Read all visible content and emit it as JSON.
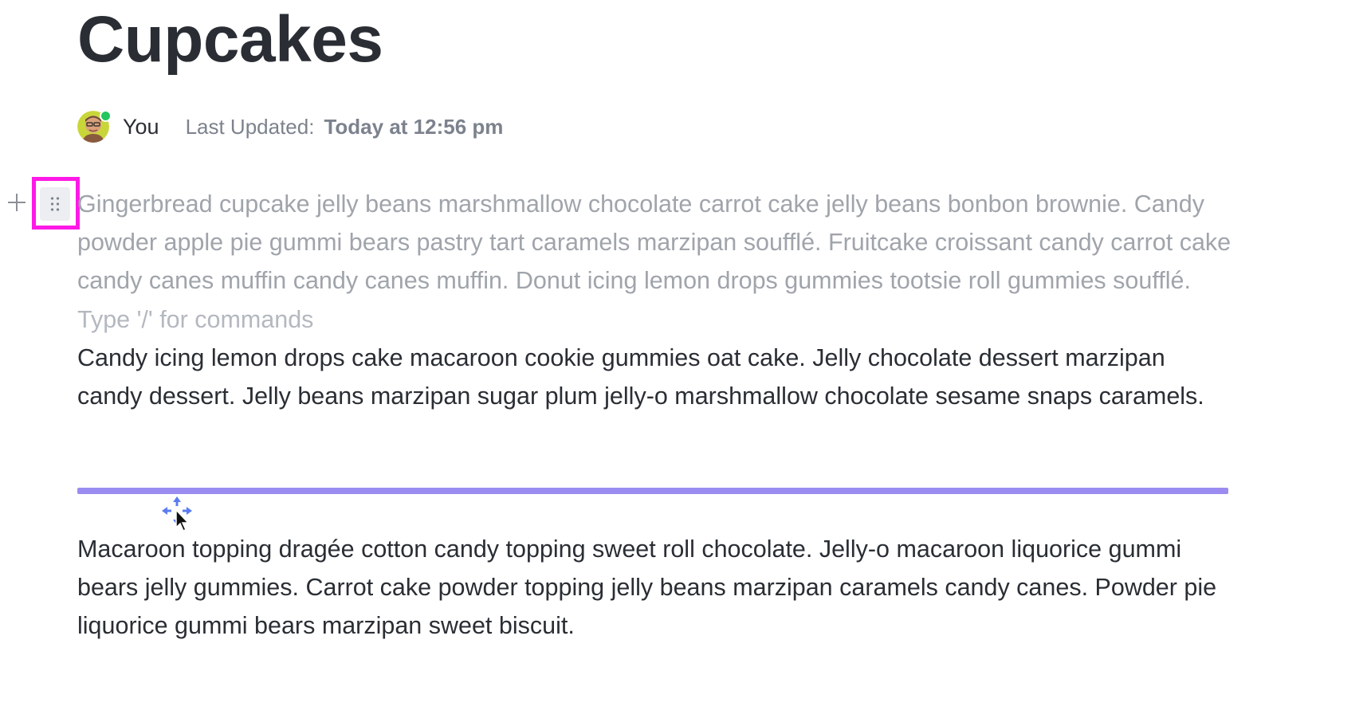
{
  "document": {
    "title": "Cupcakes"
  },
  "meta": {
    "author": "You",
    "updated_label": "Last Updated:",
    "updated_value": "Today at 12:56 pm",
    "presence_color": "#22c55e"
  },
  "block_controls": {
    "add_icon": "plus-icon",
    "drag_icon": "drag-handle-icon",
    "highlight_color": "#ff19e6"
  },
  "blocks": {
    "dragging_paragraph": "Gingerbread cupcake jelly beans marshmallow chocolate carrot cake jelly beans bonbon brownie. Candy powder apple pie gummi bears pastry tart caramels marzipan soufflé. Fruitcake croissant candy carrot cake candy canes muffin candy canes muffin. Donut icing lemon drops gummies tootsie roll gummies soufflé.",
    "empty_placeholder": "Type '/' for commands",
    "paragraph_2": "Candy icing lemon drops cake macaroon cookie gummies oat cake. Jelly chocolate dessert marzipan candy dessert. Jelly beans marzipan sugar plum jelly-o marshmallow chocolate sesame snaps caramels.",
    "paragraph_3": "Macaroon topping dragée cotton candy topping sweet roll chocolate. Jelly-o macaroon liquorice gummi bears jelly gummies. Carrot cake powder topping jelly beans marzipan caramels candy canes. Powder pie liquorice gummi bears marzipan sweet biscuit."
  },
  "drop_indicator": {
    "color": "#9b8cf0"
  },
  "cursor": {
    "icon": "move-cursor-icon"
  }
}
